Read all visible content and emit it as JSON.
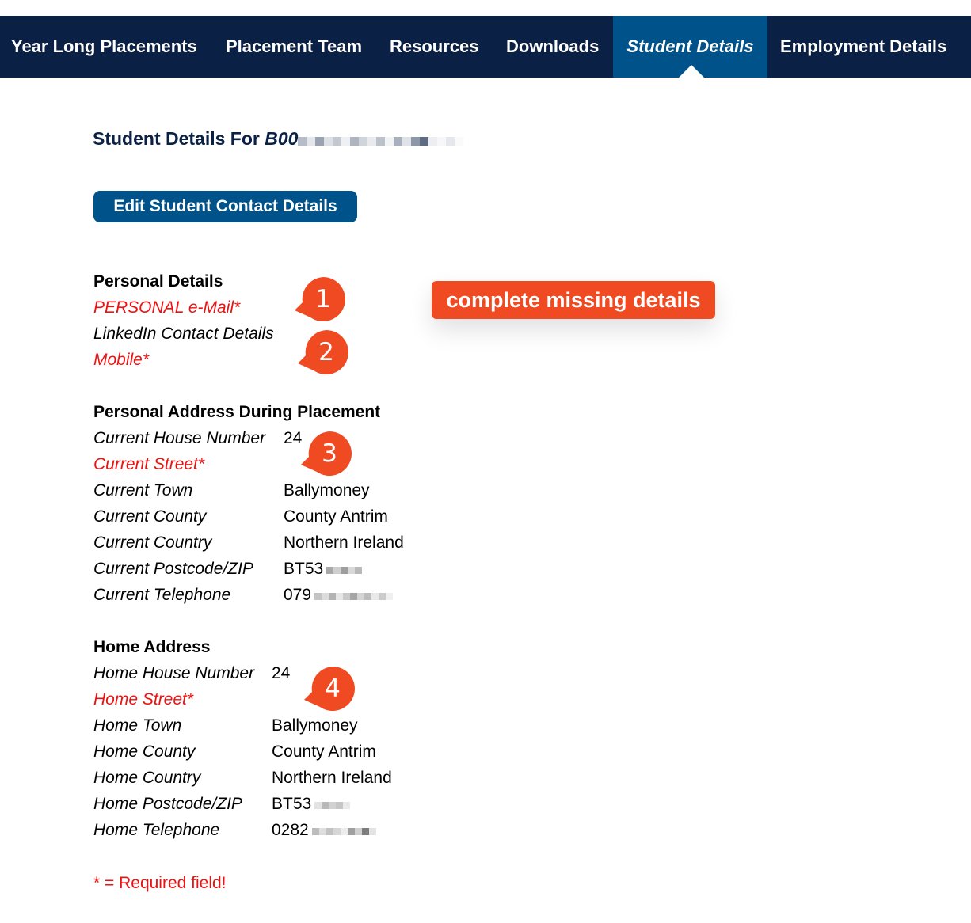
{
  "nav": {
    "items": [
      {
        "label": "Year Long Placements"
      },
      {
        "label": "Placement Team"
      },
      {
        "label": "Resources"
      },
      {
        "label": "Downloads"
      },
      {
        "label": "Student Details",
        "active": true
      },
      {
        "label": "Employment Details"
      }
    ]
  },
  "page": {
    "heading_prefix": "Student Details For ",
    "student_id_visible": "B00",
    "edit_button_label": "Edit Student Contact Details"
  },
  "personal_details": {
    "title": "Personal Details",
    "fields": [
      {
        "label": "PERSONAL e-Mail*",
        "required": true,
        "value": ""
      },
      {
        "label": "LinkedIn Contact Details",
        "required": false,
        "value": ""
      },
      {
        "label": "Mobile*",
        "required": true,
        "value": ""
      }
    ]
  },
  "placement_address": {
    "title": "Personal Address During Placement",
    "fields": [
      {
        "label": "Current House Number",
        "value": "24"
      },
      {
        "label": "Current Street*",
        "required": true,
        "value": ""
      },
      {
        "label": "Current Town",
        "value": "Ballymoney"
      },
      {
        "label": "Current County",
        "value": "County Antrim"
      },
      {
        "label": "Current Country",
        "value": "Northern Ireland"
      },
      {
        "label": "Current Postcode/ZIP",
        "value": "BT53"
      },
      {
        "label": "Current Telephone",
        "value": "079"
      }
    ]
  },
  "home_address": {
    "title": "Home Address",
    "fields": [
      {
        "label": "Home House Number",
        "value": "24"
      },
      {
        "label": "Home Street*",
        "required": true,
        "value": ""
      },
      {
        "label": "Home Town",
        "value": "Ballymoney"
      },
      {
        "label": "Home County",
        "value": "County Antrim"
      },
      {
        "label": "Home Country",
        "value": "Northern Ireland"
      },
      {
        "label": "Home Postcode/ZIP",
        "value": "BT53"
      },
      {
        "label": "Home Telephone",
        "value": "0282"
      }
    ]
  },
  "annotations": {
    "banner": "complete missing details",
    "pins": [
      "1",
      "2",
      "3",
      "4"
    ],
    "pin_color": "#f04a23"
  },
  "footnote": "* = Required field!",
  "colors": {
    "nav_bg": "#0b2045",
    "nav_active_bg": "#00538a",
    "button_bg": "#00538a",
    "required_text": "#ee1111",
    "heading_text": "#0b2045"
  }
}
